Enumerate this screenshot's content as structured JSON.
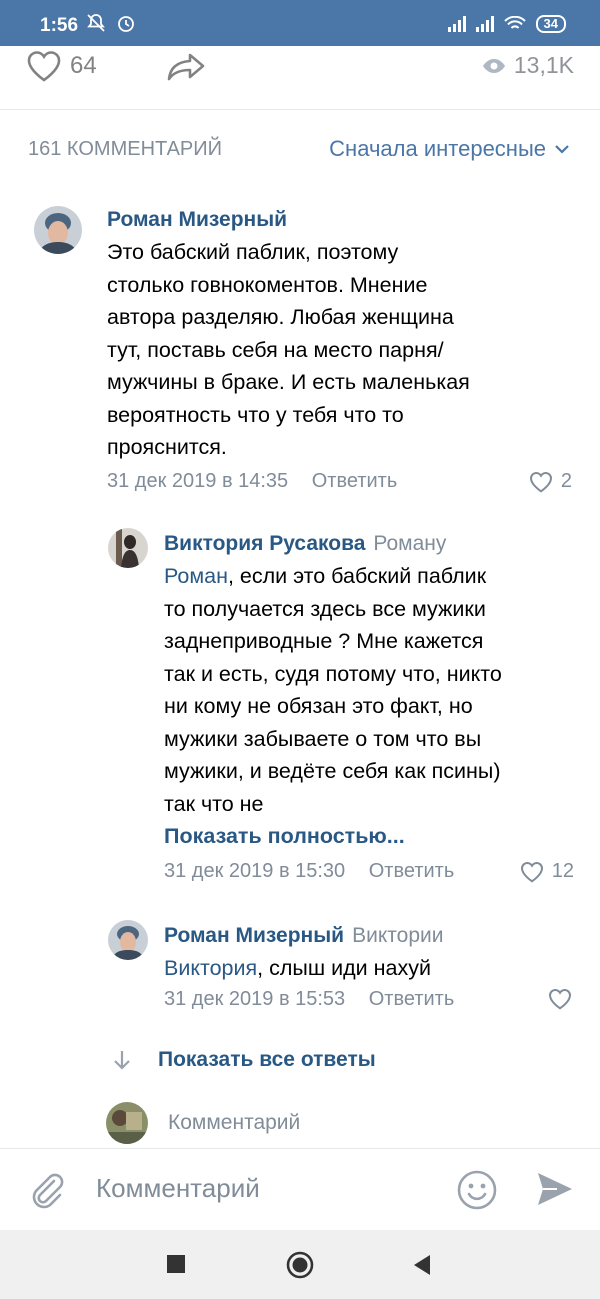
{
  "status_bar": {
    "time": "1:56",
    "battery": "34"
  },
  "post_actions": {
    "likes": "64",
    "views": "13,1K"
  },
  "comments_header": {
    "count_label": "161 КОММЕНТАРИЙ",
    "sort_label": "Сначала интересные"
  },
  "comments": [
    {
      "author": "Роман Мизерный",
      "reply_to": "",
      "mention": "",
      "text_lines": [
        "Это бабский паблик, поэтому",
        "столько говнокоментов. Мнение",
        "автора разделяю. Любая женщина",
        "тут, поставь себя на место парня/",
        "мужчины в браке. И есть маленькая",
        "вероятность что у тебя что то",
        "прояснится."
      ],
      "date": "31 дек 2019 в 14:35",
      "reply_label": "Ответить",
      "likes": "2"
    },
    {
      "author": "Виктория Русакова",
      "reply_to": "Роману",
      "mention": "Роман",
      "text_first_rest": ", если это бабский паблик",
      "text_lines": [
        "то получается здесь все мужики",
        "заднеприводные ? Мне кажется",
        "так и есть, судя потому что, никто",
        "ни кому не обязан это факт, но",
        "мужики забываете о том что вы",
        "мужики, и ведёте себя как псины)",
        "так что не"
      ],
      "show_full": "Показать полностью...",
      "date": "31 дек 2019 в 15:30",
      "reply_label": "Ответить",
      "likes": "12"
    },
    {
      "author": "Роман Мизерный",
      "reply_to": "Виктории",
      "mention": "Виктория",
      "text_first_rest": ", слыш иди нахуй",
      "date": "31 дек 2019 в 15:53",
      "reply_label": "Ответить",
      "likes": ""
    }
  ],
  "show_all_replies": "Показать все ответы",
  "mini_comment_placeholder": "Комментарий",
  "composer": {
    "placeholder": "Комментарий"
  },
  "colors": {
    "status_bar": "#4a76a8",
    "link": "#2a5885",
    "secondary": "#818c99"
  },
  "icons": [
    "bell-off-icon",
    "alarm-icon",
    "signal-icon",
    "wifi-icon",
    "heart-icon",
    "share-icon",
    "eye-icon",
    "chevron-down-icon",
    "arrow-down-icon",
    "paperclip-icon",
    "smile-icon",
    "send-icon",
    "nav-back-icon",
    "nav-home-icon",
    "nav-recent-icon"
  ]
}
